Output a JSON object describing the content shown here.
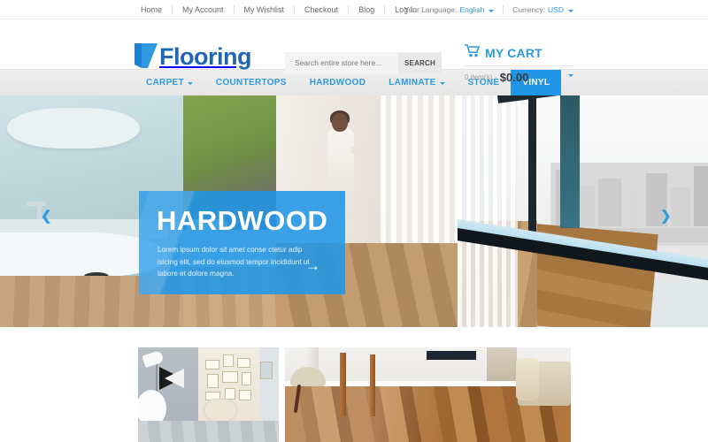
{
  "topbar": {
    "links": [
      {
        "label": "Home"
      },
      {
        "label": "My Account"
      },
      {
        "label": "My Wishlist"
      },
      {
        "label": "Checkout"
      },
      {
        "label": "Blog"
      },
      {
        "label": "Log In"
      }
    ],
    "language": {
      "label": "Your Language:",
      "value": "English"
    },
    "currency": {
      "label": "Currency:",
      "value": "USD"
    }
  },
  "header": {
    "logo": {
      "mark": "V",
      "text": "Flooring"
    },
    "search": {
      "placeholder": "Search entire store here...",
      "value": "",
      "button_label": "SEARCH"
    },
    "cart": {
      "title": "MY CART",
      "count_label": "0 item(s)",
      "separator": "-",
      "total": "$0.00"
    }
  },
  "nav": {
    "items": [
      {
        "label": "CARPET",
        "has_dropdown": true,
        "active": false
      },
      {
        "label": "COUNTERTOPS",
        "has_dropdown": false,
        "active": false
      },
      {
        "label": "HARDWOOD",
        "has_dropdown": false,
        "active": false
      },
      {
        "label": "LAMINATE",
        "has_dropdown": true,
        "active": false
      },
      {
        "label": "STONE",
        "has_dropdown": false,
        "active": false
      },
      {
        "label": "VINYL",
        "has_dropdown": false,
        "active": true
      }
    ]
  },
  "hero": {
    "title": "HARDWOOD",
    "description": "Lorem ipsum dolor sit amet conse ctetur adip isicing elit, sed do eiusmod tempor incididunt ut labore et dolore magna.",
    "arrow": "→",
    "prev_arrow": "❮",
    "next_arrow": "❯"
  },
  "promos": {
    "items": [
      {
        "name": "promo-banner-left"
      },
      {
        "name": "promo-banner-right"
      }
    ]
  },
  "colors": {
    "accent": "#2196e6",
    "link": "#2f9ae0",
    "logo_text": "#1f66b5",
    "nav_bg": "#e9e9e9",
    "text_muted": "#9b9b9b"
  }
}
